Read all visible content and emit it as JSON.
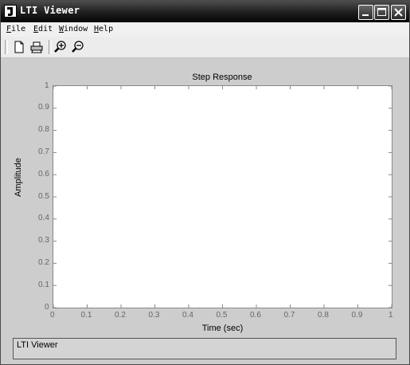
{
  "window": {
    "title": "LTI Viewer"
  },
  "menu": [
    "File",
    "Edit",
    "Window",
    "Help"
  ],
  "toolbar": {
    "buttons": [
      "new-file",
      "print",
      "zoom-in",
      "zoom-out"
    ]
  },
  "status": {
    "text": "LTI Viewer"
  },
  "chart_data": {
    "type": "line",
    "title": "Step Response",
    "xlabel": "Time (sec)",
    "ylabel": "Amplitude",
    "xlim": [
      0,
      1
    ],
    "ylim": [
      0,
      1
    ],
    "xticks": [
      "0",
      "0.1",
      "0.2",
      "0.3",
      "0.4",
      "0.5",
      "0.6",
      "0.7",
      "0.8",
      "0.9",
      "1"
    ],
    "yticks": [
      "0",
      "0.1",
      "0.2",
      "0.3",
      "0.4",
      "0.5",
      "0.6",
      "0.7",
      "0.8",
      "0.9",
      "1"
    ],
    "series": [],
    "grid": false
  }
}
